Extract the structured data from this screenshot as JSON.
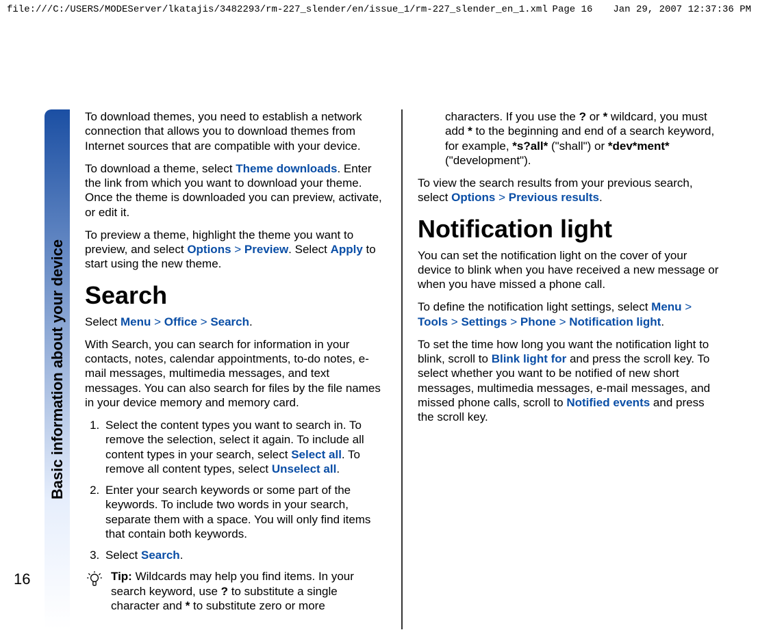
{
  "header": {
    "path": "file:///C:/USERS/MODEServer/lkatajis/3482293/rm-227_slender/en/issue_1/rm-227_slender_en_1.xml",
    "page_label": "Page 16",
    "datetime": "Jan 29, 2007 12:37:36 PM"
  },
  "sidebar": {
    "title": "Basic information about your device",
    "page_number": "16"
  },
  "col1": {
    "p1": "To download themes, you need to establish a network connection that allows you to download themes from Internet sources that are compatible with your device.",
    "p2_a": "To download a theme, select ",
    "p2_link1": "Theme downloads",
    "p2_b": ". Enter the link from which you want to download your theme. Once the theme is downloaded you can preview, activate, or edit it.",
    "p3_a": "To preview a theme, highlight the theme you want to preview, and select ",
    "p3_link1": "Options",
    "p3_chev": " > ",
    "p3_link2": "Preview",
    "p3_b": ". Select ",
    "p3_link3": "Apply",
    "p3_c": " to start using the new theme.",
    "h_search": "Search",
    "sel_a": "Select ",
    "sel_menu": "Menu",
    "sel_office": "Office",
    "sel_search": "Search",
    "sel_dot": ".",
    "p4": "With Search, you can search for information in your contacts, notes, calendar appointments, to-do notes, e-mail messages, multimedia messages, and text messages. You can also search for files by the file names in your device memory and memory card.",
    "step1_a": "Select the content types you want to search in. To remove the selection, select it again. To include all content types in your search, select ",
    "step1_link1": "Select all",
    "step1_b": ". To remove all content types, select ",
    "step1_link2": "Unselect all",
    "step1_c": ".",
    "step2": "Enter your search keywords or some part of the keywords. To include two words in your search, separate them with a space. You will only find items that contain both keywords.",
    "step3_a": "Select ",
    "step3_link": "Search",
    "step3_b": ".",
    "tip_lead": "Tip: ",
    "tip_a": "Wildcards may help you find items. In your search keyword, use ",
    "tip_q": "?",
    "tip_b": " to substitute a single character and ",
    "tip_star": "*",
    "tip_c": " to substitute zero or more"
  },
  "col2": {
    "cont_a": "characters. If you use the ",
    "cont_q": "?",
    "cont_b": " or ",
    "cont_star1": "*",
    "cont_c": " wildcard, you must add ",
    "cont_star2": "*",
    "cont_d": " to the beginning and end of a search keyword, for example, ",
    "cont_ex1": "*s?all*",
    "cont_e": " (\"shall\") or ",
    "cont_ex2": "*dev*ment*",
    "cont_f": " (\"development\").",
    "p1_a": "To view the search results from your previous search, select ",
    "p1_link1": "Options",
    "p1_chev": " > ",
    "p1_link2": "Previous results",
    "p1_b": ".",
    "h_notif": "Notification light",
    "p2": "You can set the notification light on the cover of your device to blink when you have received a new message or when you have missed a phone call.",
    "p3_a": "To define the notification light settings, select ",
    "p3_menu": "Menu",
    "p3_tools": "Tools",
    "p3_settings": "Settings",
    "p3_phone": "Phone",
    "p3_notif": "Notification light",
    "p3_b": ".",
    "p4_a": "To set the time how long you want the notification light to blink, scroll to ",
    "p4_link1": "Blink light for",
    "p4_b": " and press the scroll key. To select whether you want to be notified of new short messages, multimedia messages, e-mail messages, and missed phone calls, scroll to ",
    "p4_link2": "Notified events",
    "p4_c": " and press the scroll key."
  }
}
